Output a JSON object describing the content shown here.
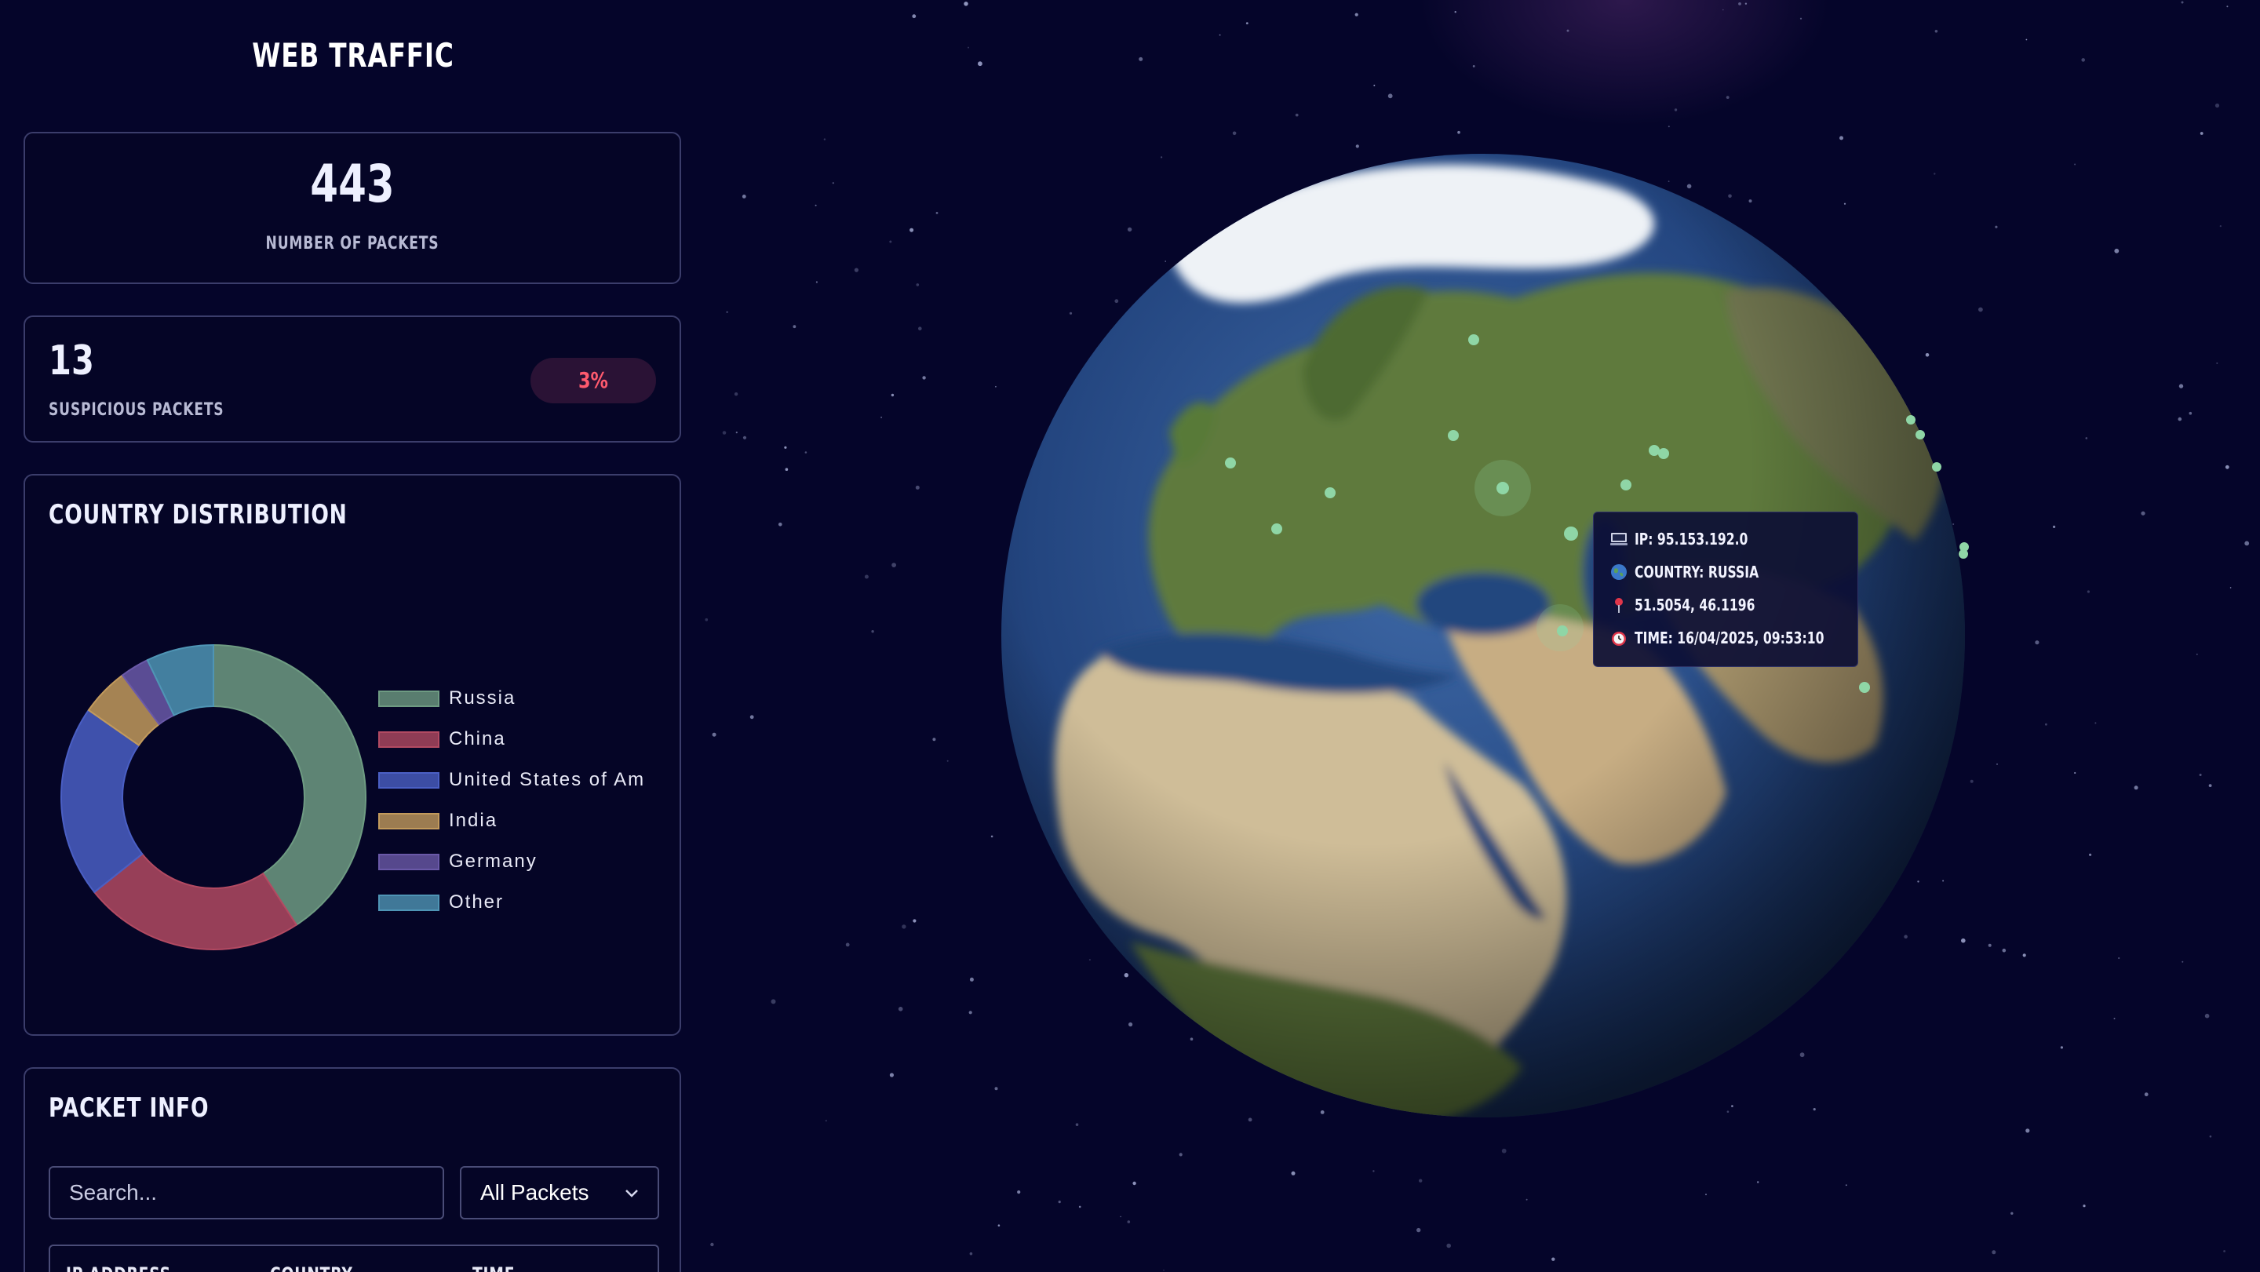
{
  "app": {
    "title": "WEB TRAFFIC"
  },
  "stats": {
    "packets": {
      "value": "443",
      "label": "NUMBER OF PACKETS"
    },
    "suspicious": {
      "value": "13",
      "label": "SUSPICIOUS PACKETS",
      "percent": "3%"
    }
  },
  "distribution": {
    "title": "COUNTRY DISTRIBUTION",
    "legend": [
      {
        "label": "Russia",
        "color": "#6e9b82"
      },
      {
        "label": "China",
        "color": "#b24a62"
      },
      {
        "label": "United States of Am",
        "color": "#4a5fc4"
      },
      {
        "label": "India",
        "color": "#c29a5c"
      },
      {
        "label": "Germany",
        "color": "#6a59a8"
      },
      {
        "label": "Other",
        "color": "#4f95b5"
      }
    ]
  },
  "chart_data": {
    "type": "pie",
    "variant": "donut",
    "categories": [
      "Russia",
      "China",
      "United States of America",
      "India",
      "Germany",
      "Other"
    ],
    "values": [
      40,
      23,
      20,
      5,
      3,
      7
    ],
    "unit": "% of packets (estimated)"
  },
  "packet_info": {
    "title": "PACKET INFO",
    "search_placeholder": "Search...",
    "filter": {
      "selected": "All Packets"
    },
    "columns": [
      "IP ADDRESS",
      "COUNTRY",
      "TIME"
    ]
  },
  "tooltip": {
    "ip": "IP: 95.153.192.0",
    "country": "COUNTRY: RUSSIA",
    "coords": "51.5054, 46.1196",
    "time": "TIME: 16/04/2025, 09:53:10"
  },
  "icons": {
    "tooltip_ip": "computer-icon",
    "tooltip_country": "globe-icon",
    "tooltip_coords": "pushpin-icon",
    "tooltip_time": "alarm-clock-icon",
    "filter": "chevron-down-icon"
  },
  "colors": {
    "background": "#05052a",
    "card_border": "#3b3d6b",
    "danger": "#ff5a6e",
    "badge_bg": "#2a1235",
    "marker": "#8fd6a6"
  }
}
